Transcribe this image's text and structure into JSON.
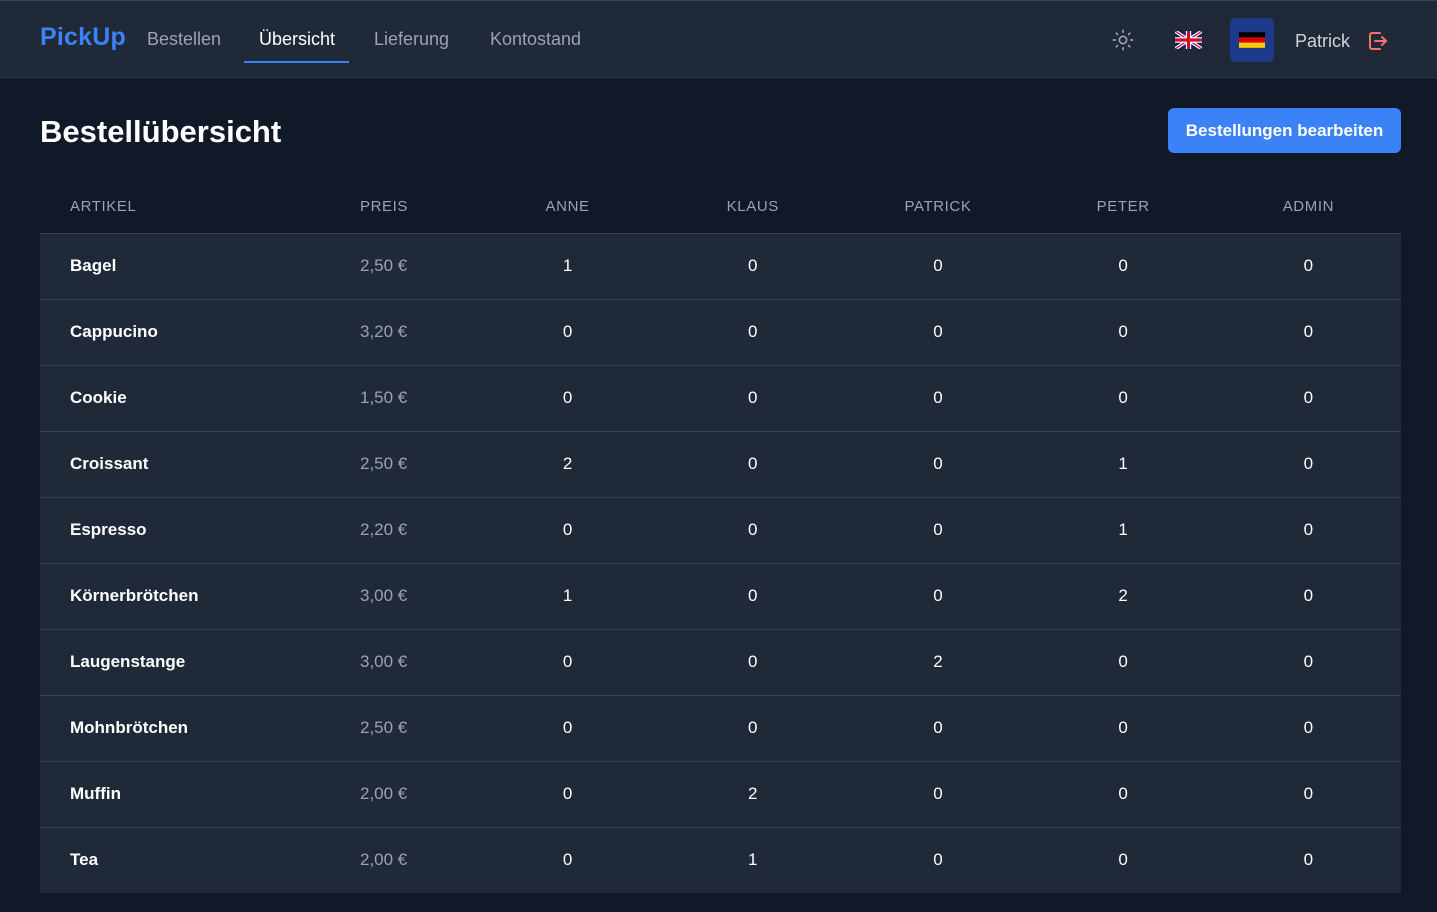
{
  "nav": {
    "brand": "PickUp",
    "links": [
      "Bestellen",
      "Übersicht",
      "Lieferung",
      "Kontostand"
    ],
    "active_link": "Übersicht",
    "user_name": "Patrick",
    "icons": {
      "theme": "sun-icon",
      "language_en": "uk-flag-icon",
      "language_de": "german-flag-icon",
      "logout": "logout-icon"
    },
    "selected_language": "de"
  },
  "page": {
    "title": "Bestellübersicht",
    "edit_button": "Bestellungen bearbeiten"
  },
  "table": {
    "headers": [
      "ARTIKEL",
      "PREIS",
      "ANNE",
      "KLAUS",
      "PATRICK",
      "PETER",
      "ADMIN"
    ],
    "rows": [
      {
        "item": "Bagel",
        "price": "2,50 €",
        "counts": [
          "1",
          "0",
          "0",
          "0",
          "0"
        ]
      },
      {
        "item": "Cappucino",
        "price": "3,20 €",
        "counts": [
          "0",
          "0",
          "0",
          "0",
          "0"
        ]
      },
      {
        "item": "Cookie",
        "price": "1,50 €",
        "counts": [
          "0",
          "0",
          "0",
          "0",
          "0"
        ]
      },
      {
        "item": "Croissant",
        "price": "2,50 €",
        "counts": [
          "2",
          "0",
          "0",
          "1",
          "0"
        ]
      },
      {
        "item": "Espresso",
        "price": "2,20 €",
        "counts": [
          "0",
          "0",
          "0",
          "1",
          "0"
        ]
      },
      {
        "item": "Körnerbrötchen",
        "price": "3,00 €",
        "counts": [
          "1",
          "0",
          "0",
          "2",
          "0"
        ]
      },
      {
        "item": "Laugenstange",
        "price": "3,00 €",
        "counts": [
          "0",
          "0",
          "2",
          "0",
          "0"
        ]
      },
      {
        "item": "Mohnbrötchen",
        "price": "2,50 €",
        "counts": [
          "0",
          "0",
          "0",
          "0",
          "0"
        ]
      },
      {
        "item": "Muffin",
        "price": "2,00 €",
        "counts": [
          "0",
          "2",
          "0",
          "0",
          "0"
        ]
      },
      {
        "item": "Tea",
        "price": "2,00 €",
        "counts": [
          "0",
          "1",
          "0",
          "0",
          "0"
        ]
      }
    ]
  },
  "colors": {
    "background": "#111827",
    "surface": "#1f2937",
    "accent": "#3b82f6",
    "logout": "#f87171"
  }
}
